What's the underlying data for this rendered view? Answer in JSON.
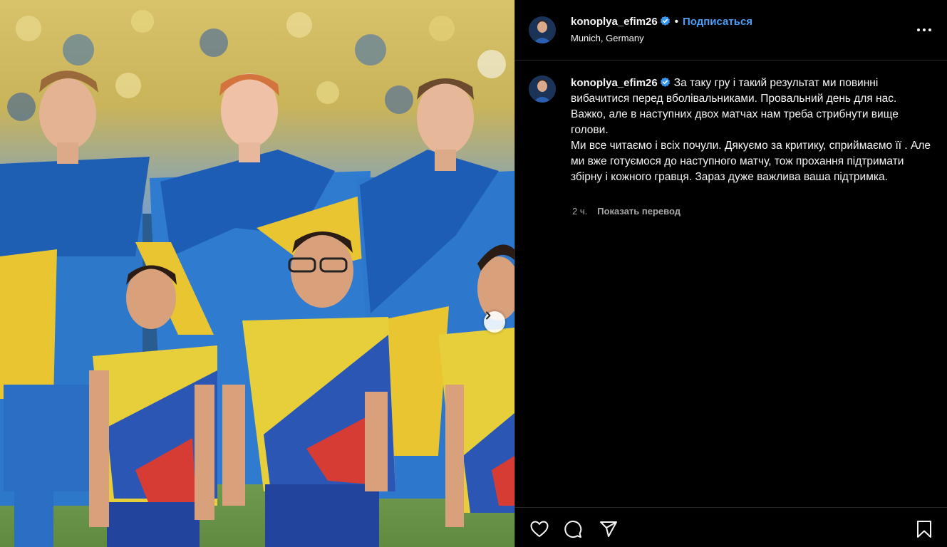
{
  "post": {
    "username": "konoplya_efim26",
    "follow_label": "Подписаться",
    "location": "Munich, Germany",
    "dot": "•",
    "verified_icon": "verified-badge-icon",
    "more_icon": "more-options-icon",
    "next_icon": "chevron-right-icon"
  },
  "caption": {
    "username": "konoplya_efim26",
    "paragraph1": "За таку гру і такий результат ми повинні вибачитися перед вболівальниками. Провальний день для нас. Важко, але в наступних двох матчах нам треба стрибнути вище голови.",
    "paragraph2": "Ми все читаємо і всіх почули. Дякуємо за критику, сприймаємо її . Але ми вже готуємося до наступного матчу, тож прохання підтримати збірну і кожного гравця. Зараз дуже важлива ваша підтримка.",
    "time": "2 ч.",
    "translate_label": "Показать перевод"
  },
  "actions": {
    "like_icon": "heart-icon",
    "comment_icon": "comment-icon",
    "share_icon": "share-icon",
    "save_icon": "bookmark-icon"
  },
  "colors": {
    "accent": "#4a9ef7",
    "verified": "#3897f0",
    "background": "#000000",
    "secondary_text": "#a8a8a8"
  }
}
